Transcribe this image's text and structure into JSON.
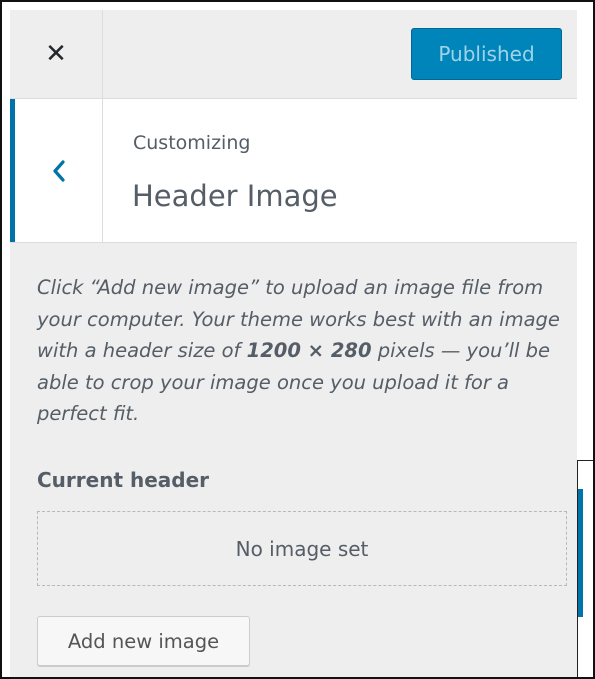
{
  "topbar": {
    "close_icon": "close-icon",
    "close_glyph": "✕",
    "publish_label": "Published"
  },
  "section": {
    "back_icon": "chevron-left-icon",
    "eyebrow": "Customizing",
    "title": "Header Image"
  },
  "description": {
    "part1": "Click “Add new image” to upload an image file from your computer. Your theme works best with an image with a header size of ",
    "size_strong": "1200 × 280",
    "part2": " pixels — you’ll be able to crop your image once you upload it for a perfect fit."
  },
  "current_header": {
    "label": "Current header",
    "placeholder_text": "No image set"
  },
  "add_button_label": "Add new image",
  "colors": {
    "accent": "#0073aa",
    "publish_bg": "#0085ba",
    "panel_bg": "#eeeeee",
    "text": "#555d66"
  }
}
